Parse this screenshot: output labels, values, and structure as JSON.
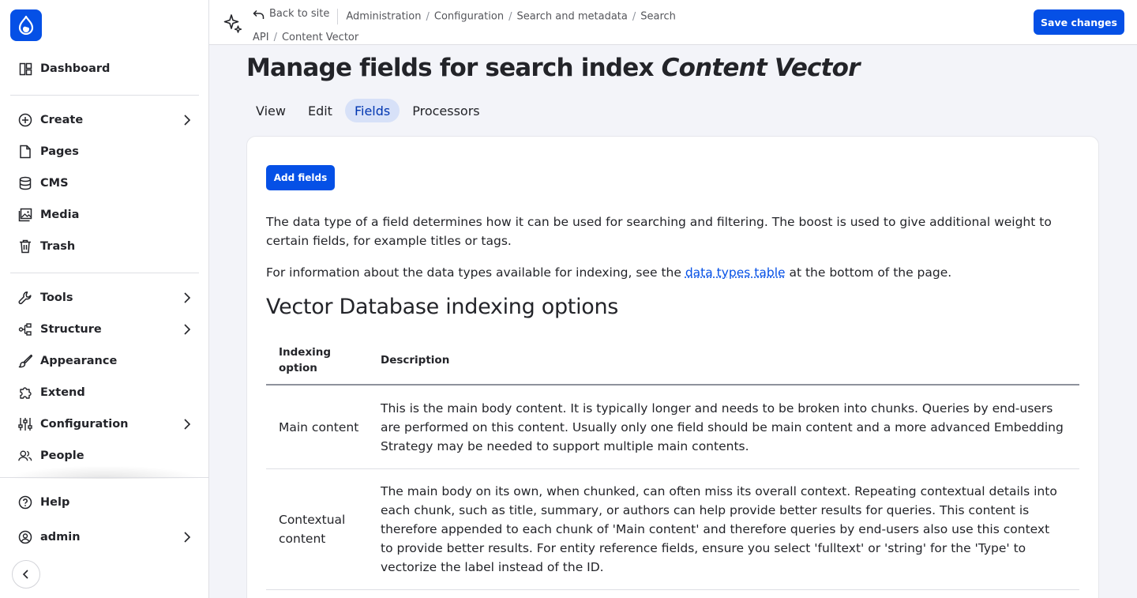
{
  "sidebar": {
    "items": [
      {
        "label": "Dashboard",
        "icon": "dashboard-icon"
      },
      {
        "label": "Create",
        "icon": "plus-circle-icon",
        "has_submenu": true
      },
      {
        "label": "Pages",
        "icon": "file-icon"
      },
      {
        "label": "CMS",
        "icon": "database-icon"
      },
      {
        "label": "Media",
        "icon": "image-icon"
      },
      {
        "label": "Trash",
        "icon": "trash-icon"
      },
      {
        "label": "Tools",
        "icon": "wrench-icon",
        "has_submenu": true
      },
      {
        "label": "Structure",
        "icon": "structure-icon",
        "has_submenu": true
      },
      {
        "label": "Appearance",
        "icon": "brush-icon"
      },
      {
        "label": "Extend",
        "icon": "puzzle-icon"
      },
      {
        "label": "Configuration",
        "icon": "sliders-icon",
        "has_submenu": true
      },
      {
        "label": "People",
        "icon": "users-icon"
      }
    ],
    "help": "Help",
    "user": "admin"
  },
  "topbar": {
    "back": "Back to site",
    "breadcrumbs": [
      "Administration",
      "Configuration",
      "Search and metadata",
      "Search",
      "API",
      "Content Vector"
    ],
    "save_label": "Save changes"
  },
  "page": {
    "title_prefix": "Manage fields for search index",
    "title_emph": "Content Vector",
    "tabs": [
      "View",
      "Edit",
      "Fields",
      "Processors"
    ],
    "active_tab": "Fields"
  },
  "content": {
    "add_button": "Add fields",
    "para1": "The data type of a field determines how it can be used for searching and filtering. The boost is used to give additional weight to certain fields, for example titles or tags.",
    "para2_before": "For information about the data types available for indexing, see the ",
    "para2_link": "data types table",
    "para2_after": " at the bottom of the page.",
    "section_title": "Vector Database indexing options",
    "table": {
      "headers": [
        "Indexing option",
        "Description"
      ],
      "rows": [
        {
          "option": "Main content",
          "description": "This is the main body content. It is typically longer and needs to be broken into chunks. Queries by end-users are performed on this content. Usually only one field should be main content and a more advanced Embedding Strategy may be needed to support multiple main contents."
        },
        {
          "option": "Contextual content",
          "description": "The main body on its own, when chunked, can often miss its overall context. Repeating contextual details into each chunk, such as title, summary, or authors can help provide better results for queries. This content is therefore ap­pended to each chunk of 'Main content' and therefore queries by end-users also use this context to provide better results. For entity reference fields, ensure you select 'fulltext' or 'string' for the 'Type' to vectorize the label instead of the ID."
        }
      ]
    }
  },
  "colors": {
    "accent": "#0550e6",
    "active_tab_bg": "#d7e1f8",
    "active_tab_text": "#0036b1"
  }
}
